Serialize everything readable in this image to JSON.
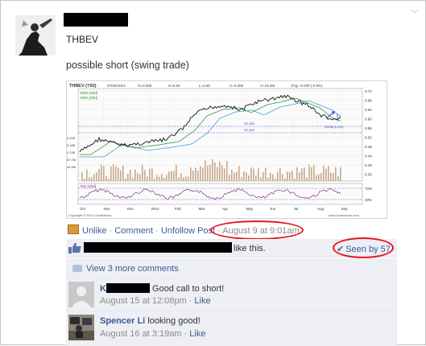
{
  "post": {
    "author_name": "THBEV",
    "status_text": "possible short (swing trade)"
  },
  "chart_image": {
    "symbol_label": "THBEV (Y92)",
    "header_stats": [
      "07/08/2013",
      "O=0.555",
      "H=0.56",
      "L=0.55",
      "C=0.555",
      "V=19.3M",
      "Chg=-0.005 (-0.9%)"
    ],
    "ema_labels": [
      "EMA (50d)",
      "EMA (20d)"
    ],
    "rsi_label": "RSI (20d)",
    "x_labels": [
      "Oct",
      "Nov",
      "Dec",
      "2013",
      "Feb",
      "Mar",
      "Apr",
      "May",
      "Jun",
      "Jul",
      "Aug",
      "Sep"
    ],
    "y_labels": [
      "0.72",
      "0.68",
      "0.64",
      "0.60",
      "0.56",
      "0.52",
      "0.48",
      "0.44",
      "0.40",
      "0.36"
    ],
    "left_labels": [
      "0.228",
      "0.188",
      "0.138",
      "87.7M",
      "43.9M"
    ],
    "rsi_levels": [
      "70%",
      "30%"
    ],
    "level_labels": [
      "S0.455",
      "S0.455",
      "WDIB (0.5%)"
    ],
    "copyright": "Copyright © 2013 ChartNexus",
    "site": "www.chartnexus.com"
  },
  "actions": {
    "unlike": "Unlike",
    "comment": "Comment",
    "unfollow": "Unfollow Post",
    "timestamp": "August 9 at 9:01am"
  },
  "likes": {
    "suffix": "like this.",
    "seen_by": "Seen by 57"
  },
  "more_comments": "View 3 more comments",
  "comments": [
    {
      "name_initial": "K",
      "text": "Good call to short!",
      "time": "August 15 at 12:08pm",
      "like": "Like"
    },
    {
      "name": "Spencer Li",
      "text": "looking good!",
      "time": "August 16 at 3:19am",
      "like": "Like"
    }
  ],
  "colors": {
    "link": "#3b5998",
    "annotation_red": "#e8141d",
    "bar_bg": "#edeff4"
  }
}
